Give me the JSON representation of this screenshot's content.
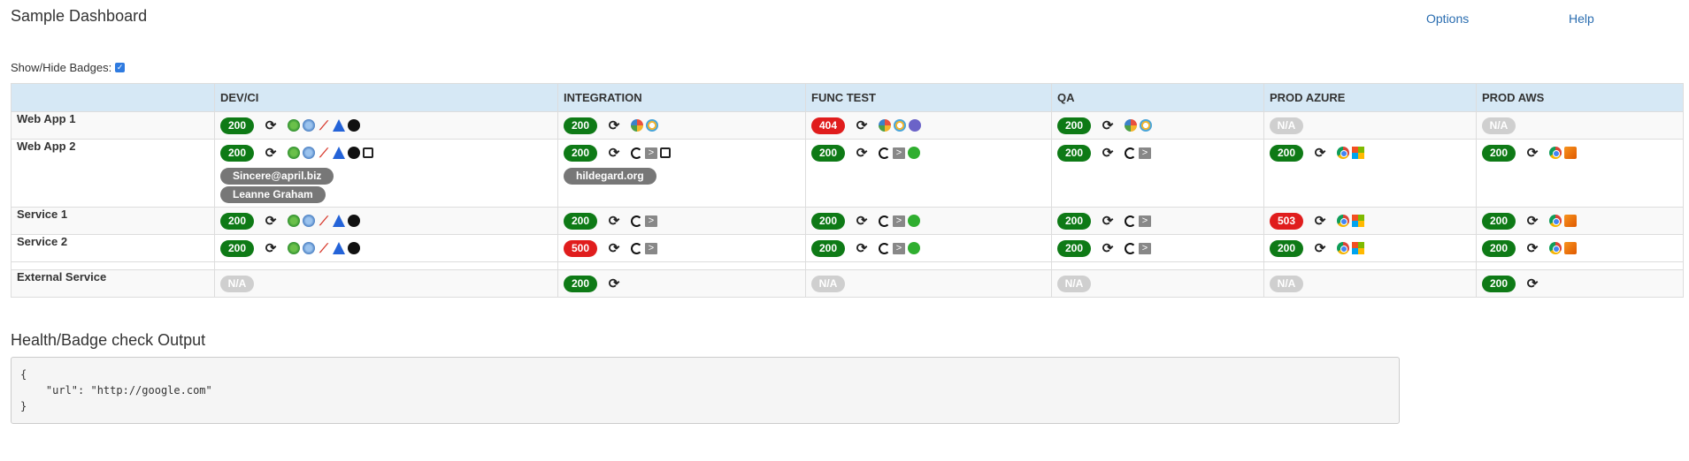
{
  "header": {
    "title": "Sample Dashboard",
    "nav": [
      "Options",
      "Help"
    ]
  },
  "toggle": {
    "label": "Show/Hide Badges:",
    "checked": true
  },
  "columns": [
    "",
    "DEV/CI",
    "INTEGRATION",
    "FUNC TEST",
    "QA",
    "PROD AZURE",
    "PROD AWS"
  ],
  "rows": [
    {
      "name": "Web App 1",
      "cells": [
        {
          "status": "200",
          "refresh": true,
          "icons": [
            "globe-icon",
            "world-icon",
            "slash-icon",
            "triangle-icon",
            "github-icon"
          ]
        },
        {
          "status": "200",
          "refresh": true,
          "icons": [
            "fan-icon",
            "ring-icon"
          ]
        },
        {
          "status": "404",
          "refresh": true,
          "icons": [
            "fan-icon",
            "ring-icon",
            "purple-icon"
          ]
        },
        {
          "status": "200",
          "refresh": true,
          "icons": [
            "fan-icon",
            "ring-icon"
          ]
        },
        {
          "status": "N/A"
        },
        {
          "status": "N/A"
        }
      ]
    },
    {
      "name": "Web App 2",
      "cells": [
        {
          "status": "200",
          "refresh": true,
          "icons": [
            "globe-icon",
            "world-icon",
            "slash-icon",
            "triangle-icon",
            "github-icon",
            "box-icon"
          ],
          "extras": [
            "Sincere@april.biz",
            "Leanne Graham"
          ]
        },
        {
          "status": "200",
          "refresh": true,
          "icons": [
            "hook-icon",
            "terminal-icon",
            "box-icon"
          ],
          "extras": [
            "hildegard.org"
          ]
        },
        {
          "status": "200",
          "refresh": true,
          "icons": [
            "hook-icon",
            "terminal-icon",
            "green-icon"
          ]
        },
        {
          "status": "200",
          "refresh": true,
          "icons": [
            "hook-icon",
            "terminal-icon"
          ]
        },
        {
          "status": "200",
          "refresh": true,
          "icons": [
            "chrome-icon",
            "microsoft-icon"
          ]
        },
        {
          "status": "200",
          "refresh": true,
          "icons": [
            "chrome-icon",
            "aws-icon"
          ]
        }
      ]
    },
    {
      "name": "Service 1",
      "cells": [
        {
          "status": "200",
          "refresh": true,
          "icons": [
            "globe-icon",
            "world-icon",
            "slash-icon",
            "triangle-icon",
            "github-icon"
          ]
        },
        {
          "status": "200",
          "refresh": true,
          "icons": [
            "hook-icon",
            "terminal-icon"
          ]
        },
        {
          "status": "200",
          "refresh": true,
          "icons": [
            "hook-icon",
            "terminal-icon",
            "green-icon"
          ]
        },
        {
          "status": "200",
          "refresh": true,
          "icons": [
            "hook-icon",
            "terminal-icon"
          ]
        },
        {
          "status": "503",
          "refresh": true,
          "icons": [
            "chrome-icon",
            "microsoft-icon"
          ]
        },
        {
          "status": "200",
          "refresh": true,
          "icons": [
            "chrome-icon",
            "aws-icon"
          ]
        }
      ]
    },
    {
      "name": "Service 2",
      "cells": [
        {
          "status": "200",
          "refresh": true,
          "icons": [
            "globe-icon",
            "world-icon",
            "slash-icon",
            "triangle-icon",
            "github-icon"
          ]
        },
        {
          "status": "500",
          "refresh": true,
          "icons": [
            "hook-icon",
            "terminal-icon"
          ]
        },
        {
          "status": "200",
          "refresh": true,
          "icons": [
            "hook-icon",
            "terminal-icon",
            "green-icon"
          ]
        },
        {
          "status": "200",
          "refresh": true,
          "icons": [
            "hook-icon",
            "terminal-icon"
          ]
        },
        {
          "status": "200",
          "refresh": true,
          "icons": [
            "chrome-icon",
            "microsoft-icon"
          ]
        },
        {
          "status": "200",
          "refresh": true,
          "icons": [
            "chrome-icon",
            "aws-icon"
          ]
        }
      ]
    },
    {
      "name": "External Service",
      "cells": [
        {
          "status": "N/A"
        },
        {
          "status": "200",
          "refresh": true
        },
        {
          "status": "N/A"
        },
        {
          "status": "N/A"
        },
        {
          "status": "N/A"
        },
        {
          "status": "200",
          "refresh": true
        }
      ]
    }
  ],
  "output": {
    "title": "Health/Badge check Output",
    "lines": [
      "{",
      "    \"url\": \"http://google.com\"",
      "}"
    ]
  },
  "colors": {
    "ok": "#0e7a16",
    "error": "#e01d1d",
    "na": "#cfcfcf",
    "header_bg": "#d6e8f5",
    "link": "#2a6db0"
  }
}
